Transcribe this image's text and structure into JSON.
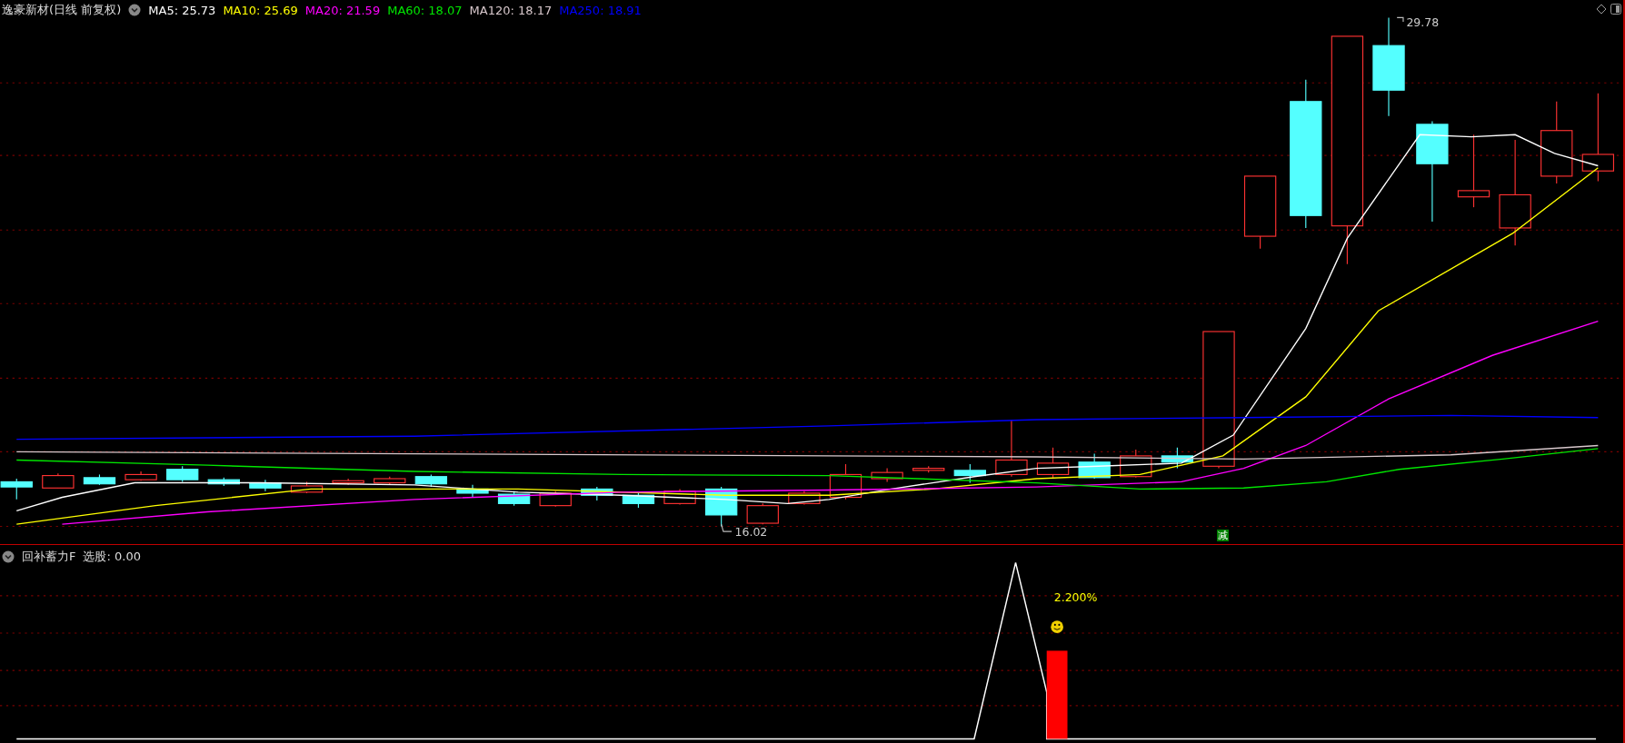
{
  "main_chart": {
    "title": "逸豪新材(日线 前复权)",
    "indicators": [
      {
        "label": "MA5: 25.73",
        "color": "#ffffff"
      },
      {
        "label": "MA10: 25.69",
        "color": "#ffff00"
      },
      {
        "label": "MA20: 21.59",
        "color": "#ff00ff"
      },
      {
        "label": "MA60: 18.07",
        "color": "#00e600"
      },
      {
        "label": "MA120: 18.17",
        "color": "#d8c8cc"
      },
      {
        "label": "MA250: 18.91",
        "color": "#0000ff"
      }
    ],
    "high_label": "29.78",
    "low_label": "16.02",
    "signal_tag": "减"
  },
  "sub_chart": {
    "title": "回补蓄力F",
    "reading": "选股: 0.00",
    "value_label": "2.200%"
  }
}
